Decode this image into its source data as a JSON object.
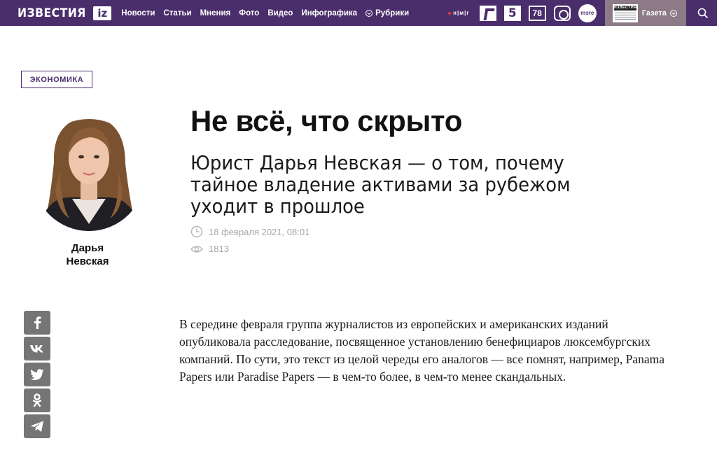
{
  "header": {
    "logo_text": "ИЗВЕСТИЯ",
    "logo_badge": "iz",
    "nav": [
      "Новости",
      "Статьи",
      "Мнения",
      "Фото",
      "Видео",
      "Инфографика"
    ],
    "rubriki_label": "Рубрики",
    "partners": {
      "nmg": "н|м|г",
      "five": "5",
      "seventy_eight": "78",
      "more": "mɔre"
    },
    "gazeta_masthead": "ИЗВЕСТИЯ",
    "gazeta_label": "Газета",
    "brand_color": "#4a2d6b"
  },
  "article": {
    "rubric": "ЭКОНОМИКА",
    "author_first": "Дарья",
    "author_last": "Невская",
    "title": "Не всё, что скрыто",
    "subtitle": "Юрист Дарья Невская — о том, почему тайное владение активами за рубежом уходит в прошлое",
    "date": "18 февраля 2021, 08:01",
    "views": "1813",
    "body": "В середине февраля группа журналистов из европейских и американских изданий опубликовала расследование, посвященное установлению бенефициаров люксембургских компаний. По сути, это текст из целой череды его аналогов — все помнят, например, Panama Papers или Paradise Papers — в чем-то более, в чем-то менее скандальных."
  },
  "share": {
    "facebook": "f",
    "vk": "vk",
    "twitter": "twitter",
    "odnoklassniki": "ok",
    "telegram": "telegram"
  }
}
